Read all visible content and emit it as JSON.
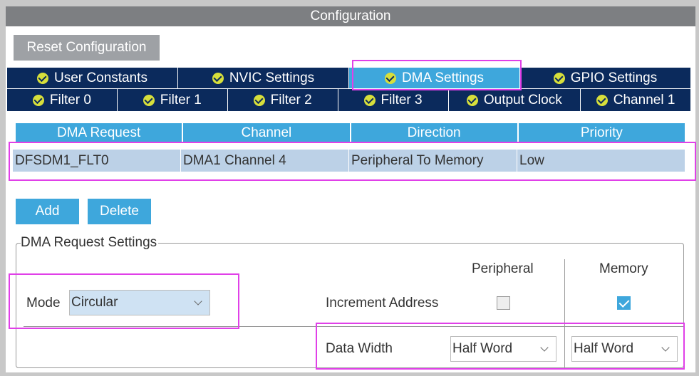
{
  "window": {
    "title": "Configuration"
  },
  "toolbar": {
    "reset_label": "Reset Configuration"
  },
  "tabs_row1": [
    {
      "label": "User Constants",
      "active": false
    },
    {
      "label": "NVIC Settings",
      "active": false
    },
    {
      "label": "DMA Settings",
      "active": true
    },
    {
      "label": "GPIO Settings",
      "active": false
    }
  ],
  "tabs_row2": [
    {
      "label": "Filter 0"
    },
    {
      "label": "Filter 1"
    },
    {
      "label": "Filter 2"
    },
    {
      "label": "Filter 3"
    },
    {
      "label": "Output Clock"
    },
    {
      "label": "Channel 1"
    }
  ],
  "dma_table": {
    "headers": [
      "DMA Request",
      "Channel",
      "Direction",
      "Priority"
    ],
    "rows": [
      [
        "DFSDM1_FLT0",
        "DMA1 Channel 4",
        "Peripheral To Memory",
        "Low"
      ]
    ]
  },
  "actions": {
    "add_label": "Add",
    "delete_label": "Delete"
  },
  "settings": {
    "group_title": "DMA Request Settings",
    "mode_label": "Mode",
    "mode_value": "Circular",
    "peripheral_header": "Peripheral",
    "memory_header": "Memory",
    "increment_label": "Increment Address",
    "increment_peripheral": false,
    "increment_memory": true,
    "data_width_label": "Data Width",
    "peripheral_width": "Half Word",
    "memory_width": "Half Word"
  },
  "colors": {
    "accent": "#3ea7dc",
    "tab_bg": "#0b2a5c",
    "highlight": "#e040e8"
  }
}
